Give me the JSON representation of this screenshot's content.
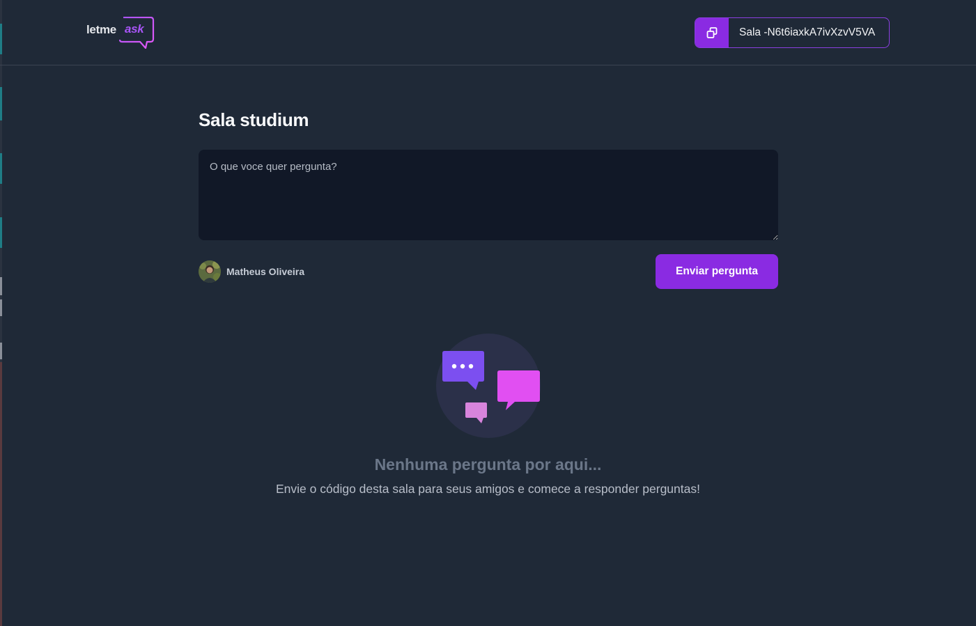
{
  "header": {
    "logo": {
      "text_part1": "letme",
      "text_part2": "ask"
    },
    "room_code_label": "Sala -N6t6iaxkA7ivXzvV5VA"
  },
  "main": {
    "room_title": "Sala studium",
    "question_input": {
      "placeholder": "O que voce quer pergunta?",
      "value": ""
    },
    "user": {
      "name": "Matheus Oliveira"
    },
    "send_button_label": "Enviar pergunta"
  },
  "empty_state": {
    "title": "Nenhuma pergunta por aqui...",
    "description": "Envie o código desta sala para seus amigos e comece a responder perguntas!"
  },
  "colors": {
    "background": "#1f2937",
    "input_background": "#111827",
    "accent": "#8a2be2",
    "accent_pink": "#e559f9",
    "text_muted": "#6b7789"
  },
  "icons": {
    "copy": "copy-icon",
    "empty_state": "chat-bubbles-icon"
  }
}
